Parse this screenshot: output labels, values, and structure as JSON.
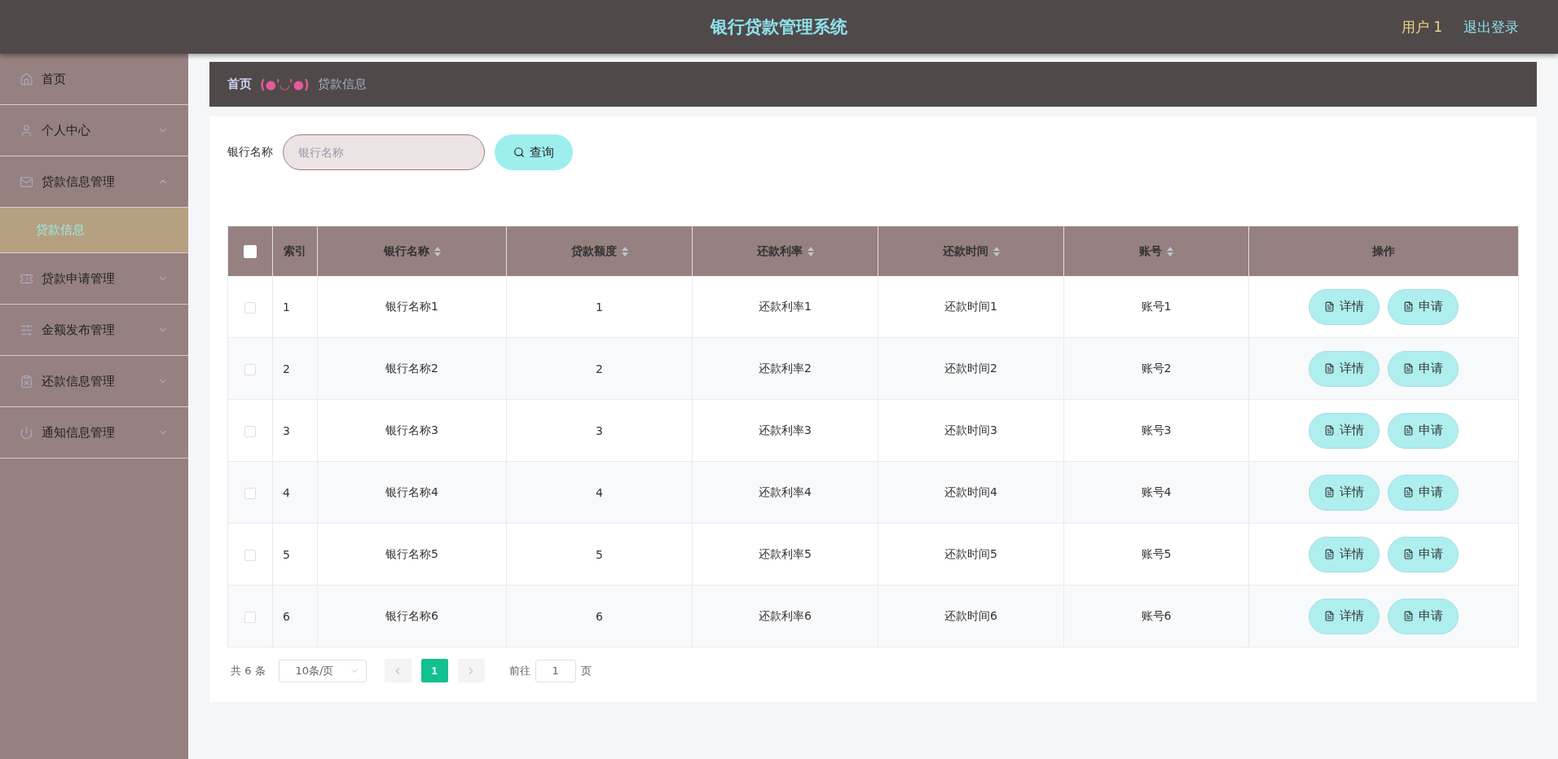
{
  "header": {
    "title": "银行贷款管理系统",
    "user": "用户 1",
    "logout": "退出登录"
  },
  "sidebar": {
    "items": [
      {
        "label": "首页",
        "kind": "link",
        "selected": false
      },
      {
        "label": "个人中心",
        "kind": "group",
        "expanded": false
      },
      {
        "label": "贷款信息管理",
        "kind": "group",
        "expanded": true,
        "children": [
          {
            "label": "贷款信息",
            "selected": true
          }
        ]
      },
      {
        "label": "贷款申请管理",
        "kind": "group",
        "expanded": false
      },
      {
        "label": "金额发布管理",
        "kind": "group",
        "expanded": false
      },
      {
        "label": "还款信息管理",
        "kind": "group",
        "expanded": false
      },
      {
        "label": "通知信息管理",
        "kind": "group",
        "expanded": false
      }
    ]
  },
  "breadcrumb": {
    "home": "首页",
    "separator": "(●'◡'●)",
    "current": "贷款信息"
  },
  "search": {
    "label": "银行名称",
    "placeholder": "银行名称",
    "button": "查询"
  },
  "table": {
    "select_all_checked": false,
    "columns": [
      {
        "label": "索引",
        "sortable": false
      },
      {
        "label": "银行名称",
        "sortable": true
      },
      {
        "label": "贷款额度",
        "sortable": true
      },
      {
        "label": "还款利率",
        "sortable": true
      },
      {
        "label": "还款时间",
        "sortable": true
      },
      {
        "label": "账号",
        "sortable": true
      },
      {
        "label": "操作",
        "sortable": false
      }
    ],
    "rows": [
      {
        "checked": false,
        "cells": [
          "1",
          "银行名称1",
          "1",
          "还款利率1",
          "还款时间1",
          "账号1"
        ],
        "actions": [
          "详情",
          "申请"
        ]
      },
      {
        "checked": false,
        "cells": [
          "2",
          "银行名称2",
          "2",
          "还款利率2",
          "还款时间2",
          "账号2"
        ],
        "actions": [
          "详情",
          "申请"
        ]
      },
      {
        "checked": false,
        "cells": [
          "3",
          "银行名称3",
          "3",
          "还款利率3",
          "还款时间3",
          "账号3"
        ],
        "actions": [
          "详情",
          "申请"
        ]
      },
      {
        "checked": false,
        "cells": [
          "4",
          "银行名称4",
          "4",
          "还款利率4",
          "还款时间4",
          "账号4"
        ],
        "actions": [
          "详情",
          "申请"
        ]
      },
      {
        "checked": false,
        "cells": [
          "5",
          "银行名称5",
          "5",
          "还款利率5",
          "还款时间5",
          "账号5"
        ],
        "actions": [
          "详情",
          "申请"
        ]
      },
      {
        "checked": false,
        "cells": [
          "6",
          "银行名称6",
          "6",
          "还款利率6",
          "还款时间6",
          "账号6"
        ],
        "actions": [
          "详情",
          "申请"
        ]
      }
    ]
  },
  "pagination": {
    "total": "共 6 条",
    "page_size": "10条/页",
    "prev_disabled": true,
    "next_disabled": true,
    "pages": [
      {
        "label": "1",
        "selected": true
      }
    ],
    "goto_label": "前往",
    "goto_value": "1",
    "goto_suffix": "页"
  }
}
